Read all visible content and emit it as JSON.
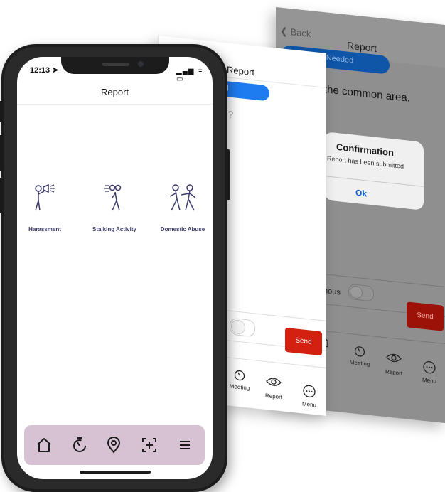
{
  "back_screen": {
    "back_label": "Back",
    "title": "Report",
    "pill_text": "r Needed",
    "message": "the common area.",
    "dialog": {
      "title": "Confirmation",
      "message": "Report has been submitted",
      "ok": "Ok"
    },
    "anonymous_label": "mous",
    "send_label": "Send",
    "tabs": [
      "ey",
      "Meeting",
      "Report",
      "Menu"
    ]
  },
  "middle_screen": {
    "title": "Report",
    "pill_text": "eded",
    "hint": "g?",
    "send_label": "Send",
    "tabs": [
      "Meeting",
      "Report",
      "Menu"
    ]
  },
  "phone": {
    "status_time": "12:13",
    "status_icons": "▂▄▆ ᯤ ▭",
    "title": "Report",
    "categories": [
      {
        "label": "Harassment",
        "icon": "harassment-icon"
      },
      {
        "label": "Stalking Activity",
        "icon": "stalking-icon"
      },
      {
        "label": "Domestic Abuse",
        "icon": "domestic-abuse-icon"
      }
    ],
    "tabbar": [
      "home-icon",
      "timer-icon",
      "location-icon",
      "add-icon",
      "menu-icon"
    ],
    "colors": {
      "tabbar_bg": "#d6c2d2",
      "icon": "#3a3a6a",
      "send": "#d42010",
      "pill": "#1f7cf0"
    }
  }
}
